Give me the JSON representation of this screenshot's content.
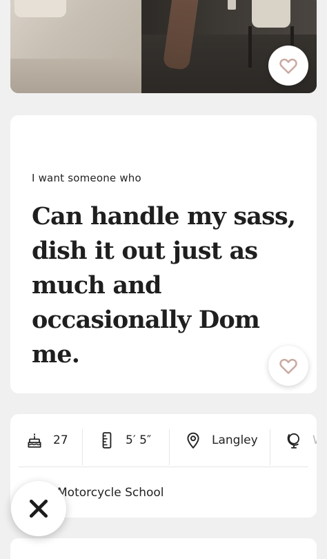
{
  "photo_card": {
    "like_icon": "heart-outline-icon"
  },
  "prompt_card": {
    "question": "I want someone who",
    "answer": "Can handle my sass, dish it out just as much and occasionally Dom me.",
    "like_icon": "heart-outline-icon"
  },
  "vitals": {
    "age": {
      "icon": "birthday-cake-icon",
      "value": "27"
    },
    "height": {
      "icon": "ruler-icon",
      "value": "5′ 5″"
    },
    "location": {
      "icon": "location-pin-icon",
      "value": "Langley"
    },
    "hometown": {
      "icon": "globe-icon",
      "value": "W"
    }
  },
  "education": {
    "value": "Motorcycle School"
  },
  "actions": {
    "dismiss_icon": "close-x-icon"
  },
  "colors": {
    "background": "#f0f0f0",
    "card": "#ffffff",
    "heart_accent": "#c9a9a0",
    "text": "#1f1f1f"
  }
}
